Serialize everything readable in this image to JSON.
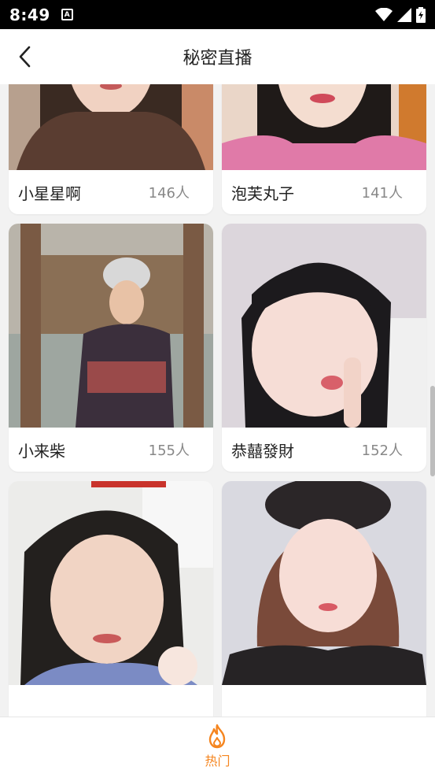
{
  "status_bar": {
    "time": "8:49",
    "notification_glyph": "A"
  },
  "header": {
    "title": "秘密直播",
    "back_icon": "chevron-left-icon"
  },
  "streams": [
    {
      "name": "小星星啊",
      "count": "146人",
      "bg": "#8a6a56"
    },
    {
      "name": "泡芙丸子",
      "count": "141人",
      "bg": "#e4cfc2"
    },
    {
      "name": "小来柴",
      "count": "155人",
      "bg": "#a39a8c"
    },
    {
      "name": "恭囍發財",
      "count": "152人",
      "bg": "#d9d4d9"
    },
    {
      "name": "",
      "count": "",
      "bg": "#e8e8e6"
    },
    {
      "name": "",
      "count": "",
      "bg": "#dcdce2"
    }
  ],
  "bottom_nav": {
    "label": "热门",
    "icon": "flame-icon",
    "accent": "#f5851f"
  }
}
